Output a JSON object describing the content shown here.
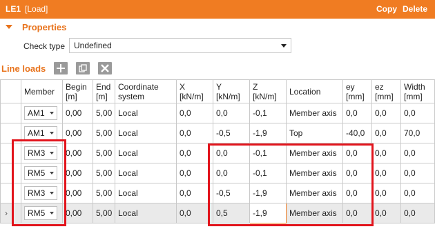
{
  "titlebar": {
    "id": "LE1",
    "subtitle": "[Load]",
    "copy_label": "Copy",
    "delete_label": "Delete",
    "color": "#f07c22"
  },
  "properties": {
    "heading": "Properties",
    "check_type_label": "Check type",
    "check_type_value": "Undefined"
  },
  "line_loads": {
    "heading": "Line loads",
    "tools": [
      "add-icon",
      "copy-icon",
      "delete-icon"
    ],
    "columns": {
      "member": "Member",
      "begin": [
        "Begin",
        "[m]"
      ],
      "end": [
        "End",
        "[m]"
      ],
      "coord": [
        "Coordinate",
        "system"
      ],
      "x": [
        "X",
        "[kN/m]"
      ],
      "y": [
        "Y",
        "[kN/m]"
      ],
      "z": [
        "Z",
        "[kN/m]"
      ],
      "location": "Location",
      "ey": [
        "ey",
        "[mm]"
      ],
      "ez": [
        "ez",
        "[mm]"
      ],
      "width": [
        "Width",
        "[mm]"
      ]
    },
    "rows": [
      {
        "mark": "",
        "member": "AM1",
        "begin": "0,00",
        "end": "5,00",
        "coord": "Local",
        "x": "0,0",
        "y": "0,0",
        "z": "-0,1",
        "location": "Member axis",
        "ey": "0,0",
        "ez": "0,0",
        "width": "0,0"
      },
      {
        "mark": "",
        "member": "AM1",
        "begin": "0,00",
        "end": "5,00",
        "coord": "Local",
        "x": "0,0",
        "y": "-0,5",
        "z": "-1,9",
        "location": "Top",
        "ey": "-40,0",
        "ez": "0,0",
        "width": "70,0"
      },
      {
        "mark": "",
        "member": "RM3",
        "begin": "0,00",
        "end": "5,00",
        "coord": "Local",
        "x": "0,0",
        "y": "0,0",
        "z": "-0,1",
        "location": "Member axis",
        "ey": "0,0",
        "ez": "0,0",
        "width": "0,0"
      },
      {
        "mark": "",
        "member": "RM5",
        "begin": "0,00",
        "end": "5,00",
        "coord": "Local",
        "x": "0,0",
        "y": "0,0",
        "z": "-0,1",
        "location": "Member axis",
        "ey": "0,0",
        "ez": "0,0",
        "width": "0,0"
      },
      {
        "mark": "",
        "member": "RM3",
        "begin": "0,00",
        "end": "5,00",
        "coord": "Local",
        "x": "0,0",
        "y": "-0,5",
        "z": "-1,9",
        "location": "Member axis",
        "ey": "0,0",
        "ez": "0,0",
        "width": "0,0"
      },
      {
        "mark": "›",
        "member": "RM5",
        "begin": "0,00",
        "end": "5,00",
        "coord": "Local",
        "x": "0,0",
        "y": "0,5",
        "z": "-1,9",
        "location": "Member axis",
        "ey": "0,0",
        "ez": "0,0",
        "width": "0,0"
      }
    ]
  }
}
